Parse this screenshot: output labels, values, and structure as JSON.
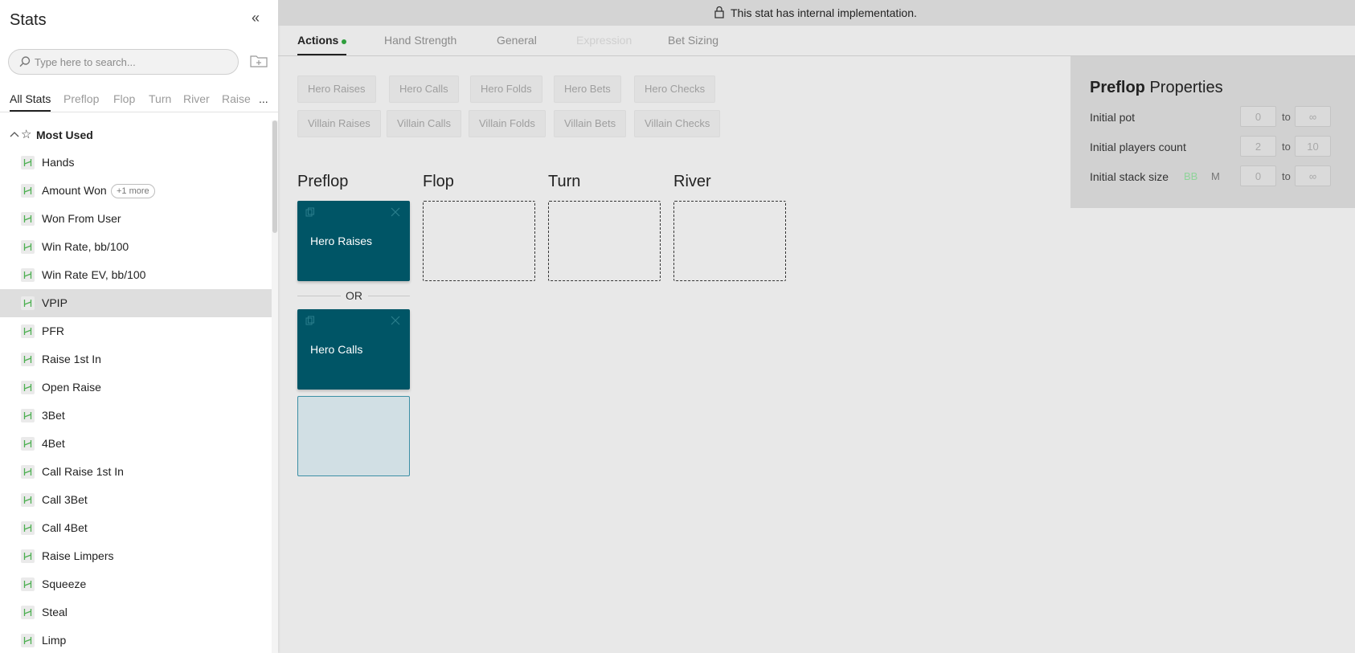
{
  "sidebar": {
    "title": "Stats",
    "search_placeholder": "Type here to search...",
    "tabs": [
      "All Stats",
      "Preflop",
      "Flop",
      "Turn",
      "River",
      "Raise",
      "..."
    ],
    "group": {
      "label": "Most Used"
    },
    "items": [
      {
        "label": "Hands"
      },
      {
        "label": "Amount Won",
        "badge": "+1 more"
      },
      {
        "label": "Won From User"
      },
      {
        "label": "Win Rate, bb/100"
      },
      {
        "label": "Win Rate EV, bb/100"
      },
      {
        "label": "VPIP",
        "selected": true
      },
      {
        "label": "PFR"
      },
      {
        "label": "Raise 1st In"
      },
      {
        "label": "Open Raise"
      },
      {
        "label": "3Bet"
      },
      {
        "label": "4Bet"
      },
      {
        "label": "Call Raise 1st In"
      },
      {
        "label": "Call 3Bet"
      },
      {
        "label": "Call 4Bet"
      },
      {
        "label": "Raise Limpers"
      },
      {
        "label": "Squeeze"
      },
      {
        "label": "Steal"
      },
      {
        "label": "Limp"
      }
    ]
  },
  "banner": {
    "message": "This stat has internal implementation."
  },
  "editor_tabs": [
    "Actions",
    "Hand Strength",
    "General",
    "Expression",
    "Bet Sizing"
  ],
  "actions": {
    "hero": [
      "Hero Raises",
      "Hero Calls",
      "Hero Folds",
      "Hero Bets",
      "Hero Checks"
    ],
    "villain": [
      "Villain Raises",
      "Villain Calls",
      "Villain Folds",
      "Villain Bets",
      "Villain Checks"
    ]
  },
  "streets": [
    "Preflop",
    "Flop",
    "Turn",
    "River"
  ],
  "preflop_cards": [
    "Hero Raises",
    "Hero Calls"
  ],
  "or_label": "OR",
  "properties": {
    "title_bold": "Preflop",
    "title_rest": " Properties",
    "initial_pot": {
      "label": "Initial pot",
      "min": "0",
      "max": "∞",
      "to": "to"
    },
    "initial_players": {
      "label": "Initial players count",
      "min": "2",
      "max": "10",
      "to": "to"
    },
    "initial_stack": {
      "label": "Initial stack size",
      "unit_bb": "BB",
      "unit_m": "M",
      "min": "0",
      "max": "∞",
      "to": "to"
    }
  },
  "colors": {
    "card": "#005566",
    "active_dot": "#2e9e3c",
    "bb_unit": "#8fd39a",
    "stat_icon": "#4caf50"
  }
}
